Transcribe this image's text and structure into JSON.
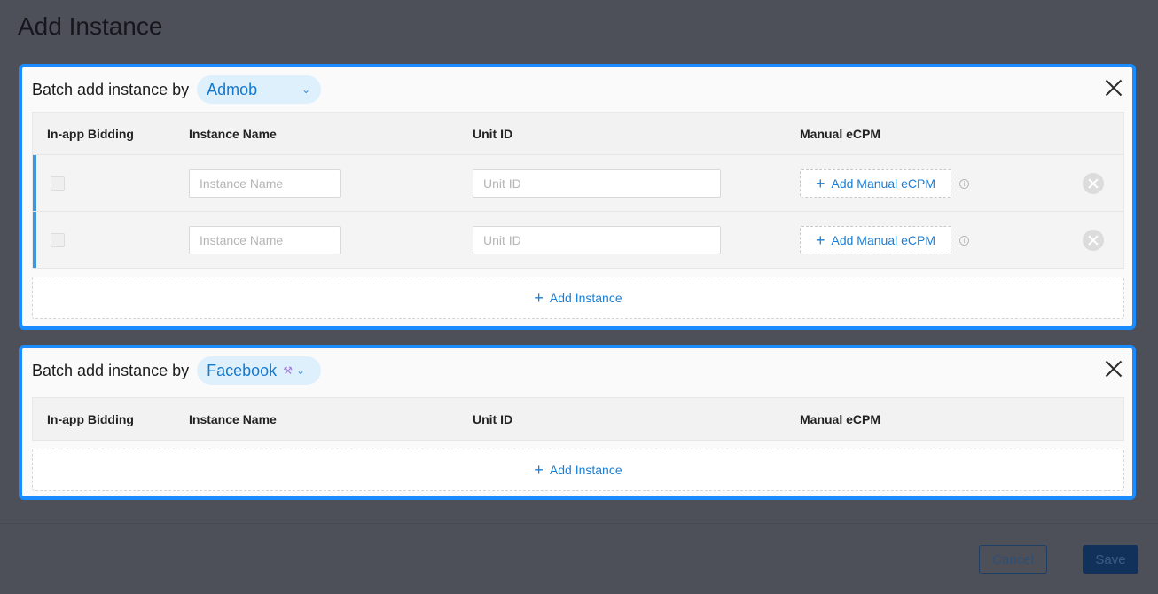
{
  "page": {
    "title": "Add Instance"
  },
  "panels": [
    {
      "prefix": "Batch add instance by",
      "network": "Admob",
      "columns": [
        "In-app Bidding",
        "Instance Name",
        "Unit ID",
        "Manual eCPM"
      ],
      "rows": [
        {
          "name_placeholder": "Instance Name",
          "unit_placeholder": "Unit ID",
          "ecpm_label": "Add Manual eCPM"
        },
        {
          "name_placeholder": "Instance Name",
          "unit_placeholder": "Unit ID",
          "ecpm_label": "Add Manual eCPM"
        }
      ],
      "add_label": "Add Instance"
    },
    {
      "prefix": "Batch add instance by",
      "network": "Facebook",
      "columns": [
        "In-app Bidding",
        "Instance Name",
        "Unit ID",
        "Manual eCPM"
      ],
      "add_label": "Add Instance"
    }
  ],
  "icons": {
    "chevron": "chevron-down-icon",
    "bidding": "hammer-icon",
    "close": "close-icon",
    "plus": "plus-icon",
    "info": "info-icon",
    "remove": "remove-circle-icon"
  },
  "footer": {
    "cancel": "Cancel",
    "save": "Save"
  },
  "colors": {
    "accent": "#1a8cff",
    "link": "#1a7fd6",
    "overlay": "#4d5058"
  }
}
